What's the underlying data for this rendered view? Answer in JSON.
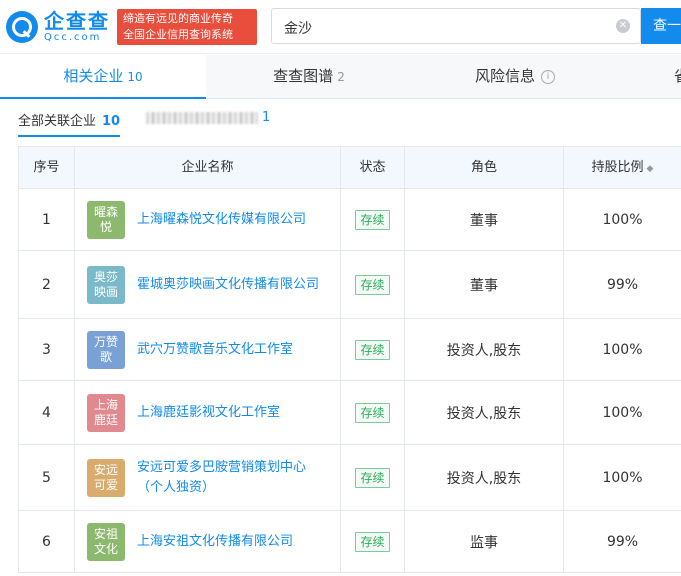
{
  "header": {
    "logo_cn": "企查查",
    "logo_en": "Qcc.com",
    "slogan_line1": "缔造有远见的商业传奇",
    "slogan_line2": "全国企业信用查询系统",
    "search_value": "金沙",
    "clear_icon": "close-circle-icon",
    "search_button": "查一"
  },
  "tabs": [
    {
      "label": "相关企业",
      "count": "10",
      "active": true
    },
    {
      "label": "查查图谱",
      "count": "2",
      "active": false
    },
    {
      "label": "风险信息",
      "count": "",
      "active": false
    },
    {
      "label": "省",
      "count": "",
      "active": false
    }
  ],
  "subfilter": {
    "all_label": "全部关联企业",
    "all_count": "10",
    "other_count": "1"
  },
  "table": {
    "columns": [
      "序号",
      "企业名称",
      "状态",
      "角色",
      "持股比例"
    ],
    "rows": [
      {
        "no": "1",
        "avatar": "曜森悦",
        "avatar_color": "#8cb96e",
        "name": "上海曜森悦文化传媒有限公司",
        "status": "存续",
        "role": "董事",
        "share": "100%"
      },
      {
        "no": "2",
        "avatar": "奥莎映画",
        "avatar_color": "#79b9c8",
        "name": "霍城奥莎映画文化传播有限公司",
        "status": "存续",
        "role": "董事",
        "share": "99%"
      },
      {
        "no": "3",
        "avatar": "万赞歌",
        "avatar_color": "#7aa1d6",
        "name": "武穴万赞歌音乐文化工作室",
        "status": "存续",
        "role": "投资人,股东",
        "share": "100%"
      },
      {
        "no": "4",
        "avatar": "上海鹿廷",
        "avatar_color": "#e0898f",
        "name": "上海鹿廷影视文化工作室",
        "status": "存续",
        "role": "投资人,股东",
        "share": "100%"
      },
      {
        "no": "5",
        "avatar": "安远可爱",
        "avatar_color": "#d9ac6e",
        "name": "安远可爱多巴胺营销策划中心（个人独资）",
        "status": "存续",
        "role": "投资人,股东",
        "share": "100%"
      },
      {
        "no": "6",
        "avatar": "安祖文化",
        "avatar_color": "#8cb96e",
        "name": "上海安祖文化传播有限公司",
        "status": "存续",
        "role": "监事",
        "share": "99%"
      }
    ]
  }
}
